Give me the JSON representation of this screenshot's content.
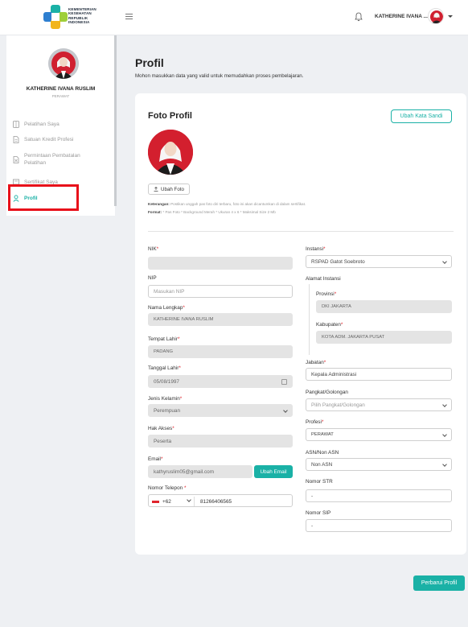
{
  "header": {
    "logo_lines": [
      "KEMENTERIAN",
      "KESEHATAN",
      "REPUBLIK",
      "INDONESIA"
    ],
    "user_name": "KATHERINE IVANA ...",
    "icons": [
      "menu-icon",
      "bell-icon",
      "chevron-down-icon"
    ]
  },
  "sidebar": {
    "name": "KATHERINE IVANA RUSLIM",
    "role": "PERAWAT",
    "items": [
      {
        "label": "Pelatihan Saya",
        "icon": "book-icon"
      },
      {
        "label": "Satuan Kredit Profesi",
        "icon": "document-icon"
      },
      {
        "label": "Permintaan Pembatalan",
        "label2": "Pelatihan",
        "icon": "cancel-document-icon"
      },
      {
        "label": "Sertifikat Saya",
        "icon": "certificate-icon"
      },
      {
        "label": "Profil",
        "icon": "user-icon",
        "active": true
      }
    ]
  },
  "main": {
    "title": "Profil",
    "subtitle": "Mohon masukkan data yang valid untuk memudahkan proses pembelajaran."
  },
  "card": {
    "title": "Foto Profil",
    "change_password_label": "Ubah Kata Sandi",
    "upload_photo_label": "Ubah Foto",
    "note1_label": "Keterangan:",
    "note1_text": "Postikan unggah pas foto diri terbaru, foto ini akan dicantumkan di dalam sertifikat.",
    "note2_label": "Format:",
    "note2_text": "* Pas Foto    * Background Merah    * Ukuran 4 x 6    * Maksimal Size 2 Mb"
  },
  "form_left": {
    "nik": {
      "label": "NIK",
      "value": ""
    },
    "nip": {
      "label": "NIP",
      "placeholder": "Masukan NIP"
    },
    "nama": {
      "label": "Nama Lengkap",
      "value": "KATHERINE IVANA RUSLIM"
    },
    "tempat_lahir": {
      "label": "Tempat Lahir",
      "value": "PADANG"
    },
    "tanggal_lahir": {
      "label": "Tanggal Lahir",
      "value": "05/08/1997"
    },
    "jenis_kelamin": {
      "label": "Jenis Kelamin",
      "value": "Perempuan"
    },
    "hak_akses": {
      "label": "Hak Akses",
      "value": "Peserta"
    },
    "email": {
      "label": "Email",
      "value": "kathyruslim05@gmail.com",
      "button": "Ubah Email"
    },
    "telepon": {
      "label": "Nomor Telepon ",
      "code": "+62",
      "value": "81266406565"
    }
  },
  "form_right": {
    "instansi": {
      "label": "Instansi",
      "value": "RSPAD Gatot Soebroto"
    },
    "alamat_label": "Alamat Instansi",
    "provinsi": {
      "label": "Provinsi",
      "value": "DKI JAKARTA"
    },
    "kabupaten": {
      "label": "Kabupaten",
      "value": "KOTA ADM. JAKARTA PUSAT"
    },
    "jabatan": {
      "label": "Jabatan",
      "value": "Kepala Administrasi"
    },
    "pangkat": {
      "label": "Pangkat/Golongan",
      "placeholder": "Pilih Pangkat/Golongan"
    },
    "profesi": {
      "label": "Profesi",
      "value": "PERAWAT"
    },
    "asn": {
      "label": "ASN/Non ASN",
      "value": "Non ASN"
    },
    "str": {
      "label": "Nomor STR",
      "value": "-"
    },
    "sip": {
      "label": "Nomor SIP",
      "value": "-"
    }
  },
  "actions": {
    "save_label": "Perbarui Profil"
  },
  "colors": {
    "accent": "#1ab1a6",
    "required": "#e0242c",
    "highlight": "#e8101a"
  }
}
